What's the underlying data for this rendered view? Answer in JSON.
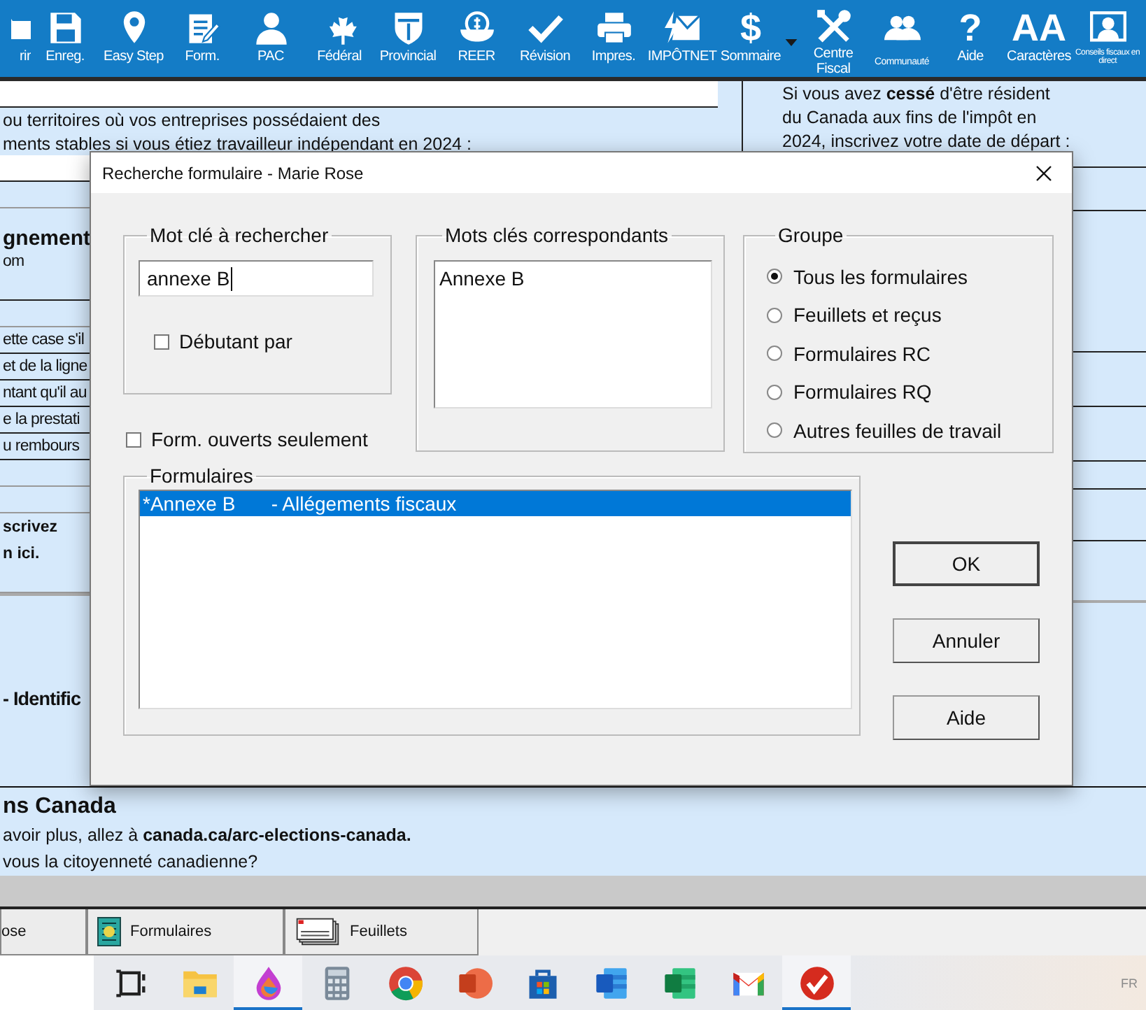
{
  "toolbar": {
    "items": [
      {
        "label": "rir"
      },
      {
        "label": "Enreg."
      },
      {
        "label": "Easy Step"
      },
      {
        "label": "Form."
      },
      {
        "label": "PAC"
      },
      {
        "label": "Fédéral"
      },
      {
        "label": "Provincial"
      },
      {
        "label": "REER"
      },
      {
        "label": "Révision"
      },
      {
        "label": "Impres."
      },
      {
        "label": "IMPÔTNET"
      },
      {
        "label": "Sommaire",
        "glyph": "$",
        "menu": true
      },
      {
        "label": "Centre Fiscal"
      },
      {
        "label": "Communauté",
        "kind": "small"
      },
      {
        "label": "Aide",
        "glyph": "?"
      },
      {
        "label": "Caractères",
        "glyph": "AA"
      },
      {
        "label": "Conseils fiscaux en direct",
        "kind": "tiny"
      }
    ]
  },
  "form": {
    "left_rows": [
      {
        "kind": "field"
      },
      {
        "kind": "text",
        "text": "ou territoires où vos entreprises possédaient des"
      },
      {
        "kind": "text",
        "text": "ments stables si vous étiez travailleur indépendant en 2024 :"
      },
      {
        "kind": "field"
      },
      {
        "kind": "gap"
      },
      {
        "kind": "heading",
        "text": "gnement"
      },
      {
        "kind": "note",
        "text": "om"
      },
      {
        "kind": "gap"
      },
      {
        "kind": "line",
        "text": "ette case s'il"
      },
      {
        "kind": "line",
        "text": "et de la ligne"
      },
      {
        "kind": "line",
        "text": "ntant qu'il au"
      },
      {
        "kind": "line",
        "text": "e la prestati"
      },
      {
        "kind": "line",
        "text": "u rembours"
      },
      {
        "kind": "gap"
      },
      {
        "kind": "gap"
      },
      {
        "kind": "strong",
        "text": "scrivez"
      },
      {
        "kind": "strong",
        "text": "n ici."
      },
      {
        "kind": "gap"
      },
      {
        "kind": "section",
        "text": "- Identific"
      }
    ],
    "right_rows": [
      {
        "kind": "text",
        "text": "Si vous avez **cessé** d'être résident"
      },
      {
        "kind": "text",
        "text": "du Canada aux fins de l'impôt en"
      },
      {
        "kind": "text",
        "text": "2024, inscrivez votre date de départ :"
      }
    ],
    "bottom_rows": [
      {
        "kind": "title",
        "text": "ns Canada"
      },
      {
        "kind": "text",
        "text": "avoir plus, allez à **canada.ca/arc-elections-canada.**"
      },
      {
        "kind": "text",
        "text": "vous la citoyenneté canadienne?"
      }
    ]
  },
  "dialog": {
    "title": "Recherche formulaire - Marie Rose",
    "keyword": {
      "label": "Mot clé à rechercher",
      "value": "annexe B",
      "starts_with": {
        "label": "Débutant par",
        "checked": false
      }
    },
    "open_only": {
      "label": "Form. ouverts seulement",
      "checked": false
    },
    "matches": {
      "label": "Mots clés correspondants",
      "items": [
        "Annexe B"
      ]
    },
    "group": {
      "label": "Groupe",
      "options": [
        {
          "label": "Tous les formulaires",
          "selected": true
        },
        {
          "label": "Feuillets et reçus",
          "selected": false
        },
        {
          "label": "Formulaires RC",
          "selected": false
        },
        {
          "label": "Formulaires RQ",
          "selected": false
        },
        {
          "label": "Autres feuilles de travail",
          "selected": false
        }
      ]
    },
    "forms": {
      "label": "Formulaires",
      "items": [
        {
          "code": "*Annexe B",
          "name": "- Allégements fiscaux",
          "selected": true
        }
      ]
    },
    "buttons": [
      {
        "label": "OK",
        "default": true
      },
      {
        "label": "Annuler",
        "default": false
      },
      {
        "label": "Aide",
        "default": false
      }
    ]
  },
  "tabs": [
    {
      "label": "ose"
    },
    {
      "label": "Formulaires"
    },
    {
      "label": "Feuillets"
    }
  ],
  "taskbar": {
    "apps": [
      {
        "active": false
      },
      {
        "active": false
      },
      {
        "active": true
      },
      {
        "active": false
      },
      {
        "active": false
      },
      {
        "active": false
      },
      {
        "active": false
      },
      {
        "active": false
      },
      {
        "active": false
      },
      {
        "active": false
      },
      {
        "active": true
      }
    ],
    "language": "FR"
  }
}
